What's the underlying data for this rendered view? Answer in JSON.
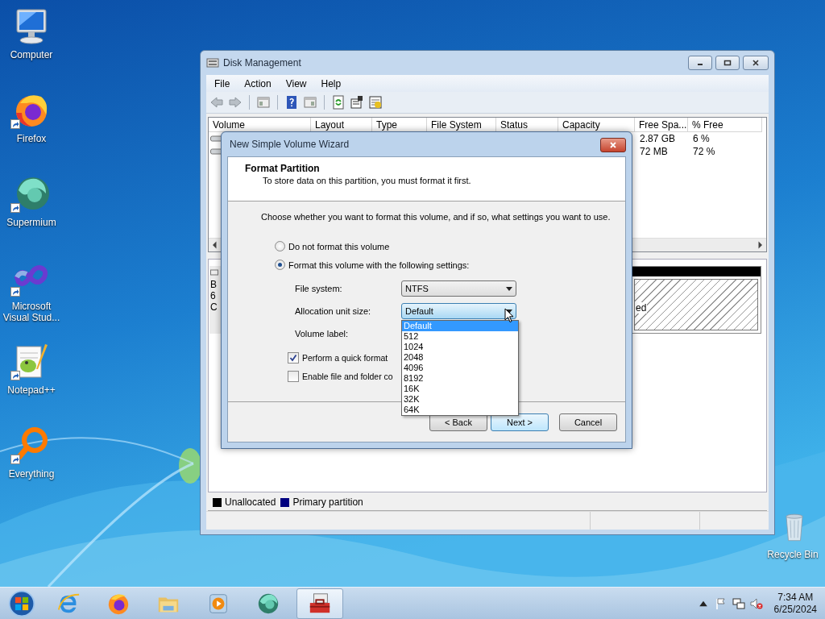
{
  "desktop_icons": [
    {
      "kind": "computer",
      "label": "Computer",
      "shortcut": false
    },
    {
      "kind": "firefox",
      "label": "Firefox",
      "shortcut": true
    },
    {
      "kind": "supermium",
      "label": "Supermium",
      "shortcut": true
    },
    {
      "kind": "visualstudio",
      "label": "Microsoft Visual Stud...",
      "shortcut": true
    },
    {
      "kind": "notepad",
      "label": "Notepad++",
      "shortcut": true
    },
    {
      "kind": "everything",
      "label": "Everything",
      "shortcut": true
    }
  ],
  "recycle_bin": {
    "label": "Recycle Bin"
  },
  "disk_window": {
    "title": "Disk Management",
    "menu": [
      "File",
      "Action",
      "View",
      "Help"
    ],
    "columns": [
      "Volume",
      "Layout",
      "Type",
      "File System",
      "Status",
      "Capacity",
      "Free Spa...",
      "% Free"
    ],
    "rows": [
      {
        "free_space": "2.87 GB",
        "percent_free": "6 %"
      },
      {
        "free_space": "72 MB",
        "percent_free": "72 %"
      }
    ],
    "disk_label_fragments": [
      "B",
      "6",
      "C"
    ],
    "partition_fragment": "ed",
    "legend": [
      {
        "label": "Unallocated",
        "color": "#000000"
      },
      {
        "label": "Primary partition",
        "color": "#000080"
      }
    ]
  },
  "wizard": {
    "title": "New Simple Volume Wizard",
    "heading": "Format Partition",
    "subheading": "To store data on this partition, you must format it first.",
    "instruction": "Choose whether you want to format this volume, and if so, what settings you want to use.",
    "options": [
      {
        "label": "Do not format this volume",
        "selected": false
      },
      {
        "label": "Format this volume with the following settings:",
        "selected": true
      }
    ],
    "file_system": {
      "label": "File system:",
      "value": "NTFS"
    },
    "allocation_unit_size": {
      "label": "Allocation unit size:",
      "value": "Default",
      "expanded": true,
      "options": [
        {
          "label": "Default",
          "selected": true
        },
        {
          "label": "512",
          "selected": false
        },
        {
          "label": "1024",
          "selected": false
        },
        {
          "label": "2048",
          "selected": false
        },
        {
          "label": "4096",
          "selected": false
        },
        {
          "label": "8192",
          "selected": false
        },
        {
          "label": "16K",
          "selected": false
        },
        {
          "label": "32K",
          "selected": false
        },
        {
          "label": "64K",
          "selected": false
        }
      ]
    },
    "volume_label": {
      "label": "Volume label:"
    },
    "checkboxes": [
      {
        "label": "Perform a quick format",
        "checked": true
      },
      {
        "label": "Enable file and folder co",
        "checked": false
      }
    ],
    "buttons": [
      {
        "label": "< Back",
        "default": false
      },
      {
        "label": "Next >",
        "default": true
      },
      {
        "label": "Cancel",
        "default": false
      }
    ]
  },
  "taskbar": {
    "apps": [
      {
        "kind": "ie",
        "active": false
      },
      {
        "kind": "firefox",
        "active": false
      },
      {
        "kind": "explorer",
        "active": false
      },
      {
        "kind": "media",
        "active": false
      },
      {
        "kind": "supermium",
        "active": false
      },
      {
        "kind": "toolbox",
        "active": true
      }
    ],
    "time": "7:34 AM",
    "date": "6/25/2024"
  }
}
